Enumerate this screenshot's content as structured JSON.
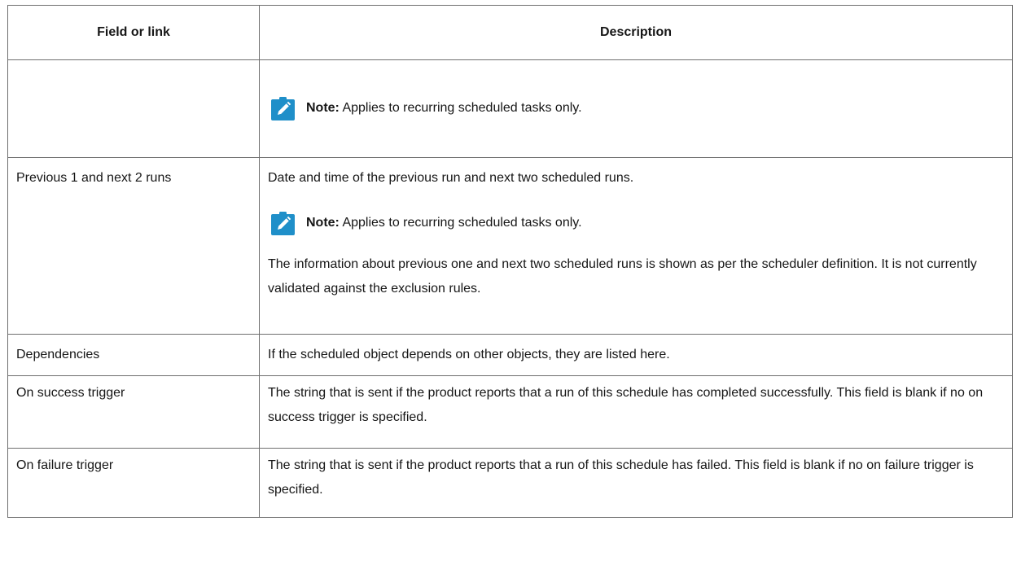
{
  "table": {
    "headers": {
      "field": "Field or link",
      "description": "Description"
    },
    "rows": [
      {
        "field": "",
        "note": {
          "label": "Note:",
          "text": "Applies to recurring scheduled tasks only."
        }
      },
      {
        "field": "Previous 1 and next 2 runs",
        "description": "Date and time of the previous run and next two scheduled runs.",
        "note": {
          "label": "Note:",
          "text": "Applies to recurring scheduled tasks only."
        },
        "extra": "The information about previous one and next two scheduled runs is shown as per the scheduler definition. It is not currently validated against the exclusion rules."
      },
      {
        "field": "Dependencies",
        "description": "If the scheduled object depends on other objects, they are listed here."
      },
      {
        "field": "On success trigger",
        "description": "The string that is sent if the product reports that a run of this schedule has completed successfully. This field is blank if no on success trigger is specified."
      },
      {
        "field": "On failure trigger",
        "description": "The string that is sent if the product reports that a run of this schedule has failed. This field is blank if no on failure trigger is specified."
      }
    ]
  },
  "icons": {
    "note": "note-pencil-icon"
  },
  "colors": {
    "note_icon_bg": "#1f8fc9",
    "border": "#6f6f6f",
    "text": "#161616"
  }
}
